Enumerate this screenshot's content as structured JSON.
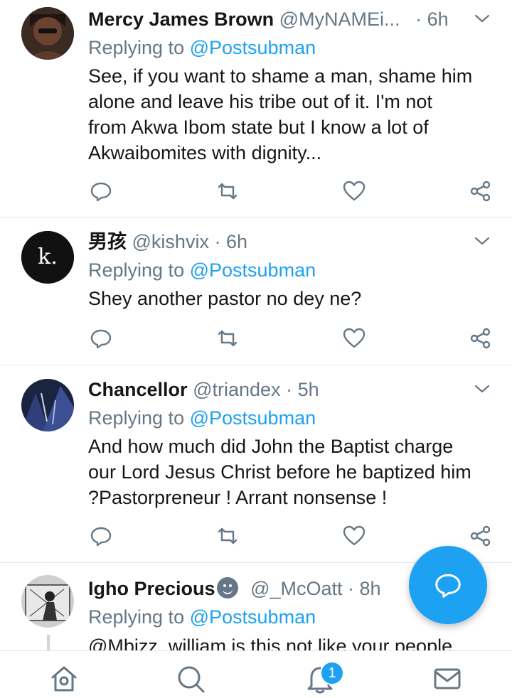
{
  "tweets": [
    {
      "name": "Mercy James Brown",
      "handle": "@MyNAMEi...",
      "dot": "·",
      "time": "6h",
      "replying_prefix": "Replying to",
      "replying_to": "@Postsubman",
      "text": "See, if you want to shame a man, shame him\nalone and leave his tribe out of it. I'm not\nfrom Akwa Ibom state but I know a lot of\nAkwaibomites with dignity..."
    },
    {
      "name": "男孩",
      "avatar_letter": "k.",
      "handle": "@kishvix",
      "dot": "·",
      "time": "6h",
      "replying_prefix": "Replying to",
      "replying_to": "@Postsubman",
      "text": "Shey another pastor no dey ne?"
    },
    {
      "name": "Chancellor",
      "handle": "@triandex",
      "dot": "·",
      "time": "5h",
      "replying_prefix": "Replying to",
      "replying_to": "@Postsubman",
      "text": "And how much did John the Baptist charge\nour Lord Jesus Christ before he baptized him\n?Pastorpreneur ! Arrant nonsense !"
    },
    {
      "name": "Igho Precious",
      "handle": "@_McOatt",
      "dot": "·",
      "time": "8h",
      "replying_prefix": "Replying to",
      "replying_to": "@Postsubman",
      "text": "@Mbizz_william is this not like your people"
    }
  ],
  "bottom_nav": {
    "notification_count": "1"
  },
  "colors": {
    "accent": "#1da1f2",
    "secondary_text": "#657786",
    "divider": "#e1e8ed"
  },
  "icons": [
    "reply-icon",
    "retweet-icon",
    "like-icon",
    "share-icon",
    "chevron-down-icon",
    "compose-reply-icon",
    "home-icon",
    "search-icon",
    "notifications-icon",
    "messages-icon"
  ]
}
